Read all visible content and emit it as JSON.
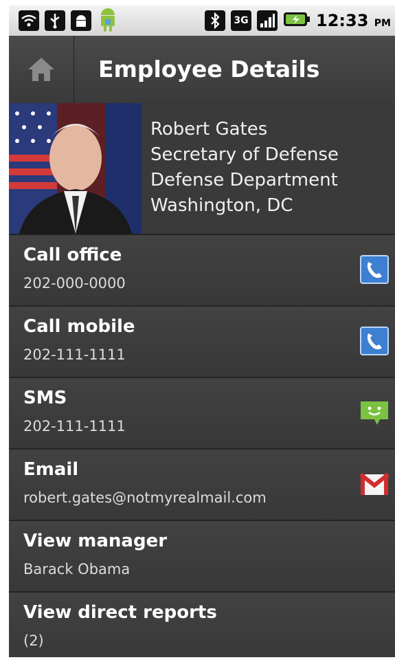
{
  "status_bar": {
    "left_icons": [
      "wifi-question-icon",
      "usb-icon",
      "android-debug-icon",
      "android-icon"
    ],
    "right_icons": [
      "bluetooth-icon",
      "network-3g-icon",
      "signal-icon",
      "battery-charging-icon"
    ],
    "network_label": "3G",
    "time": "12:33",
    "ampm": "PM"
  },
  "titlebar": {
    "home_icon": "home-icon",
    "title": "Employee Details"
  },
  "employee": {
    "name": "Robert Gates",
    "role": "Secretary of Defense",
    "department": "Defense Department",
    "location": "Washington, DC"
  },
  "actions": [
    {
      "label": "Call office",
      "value": "202-000-0000",
      "icon": "phone-icon"
    },
    {
      "label": "Call mobile",
      "value": "202-111-1111",
      "icon": "phone-icon"
    },
    {
      "label": "SMS",
      "value": "202-111-1111",
      "icon": "sms-icon"
    },
    {
      "label": "Email",
      "value": "robert.gates@notmyrealmail.com",
      "icon": "gmail-icon"
    },
    {
      "label": "View manager",
      "value": "Barack Obama",
      "icon": ""
    },
    {
      "label": "View direct reports",
      "value": "(2)",
      "icon": ""
    }
  ],
  "colors": {
    "phone_icon": "#3d7fd0",
    "sms_icon": "#7cc242",
    "gmail_red": "#d22e2e",
    "background": "#3a3a3a"
  }
}
